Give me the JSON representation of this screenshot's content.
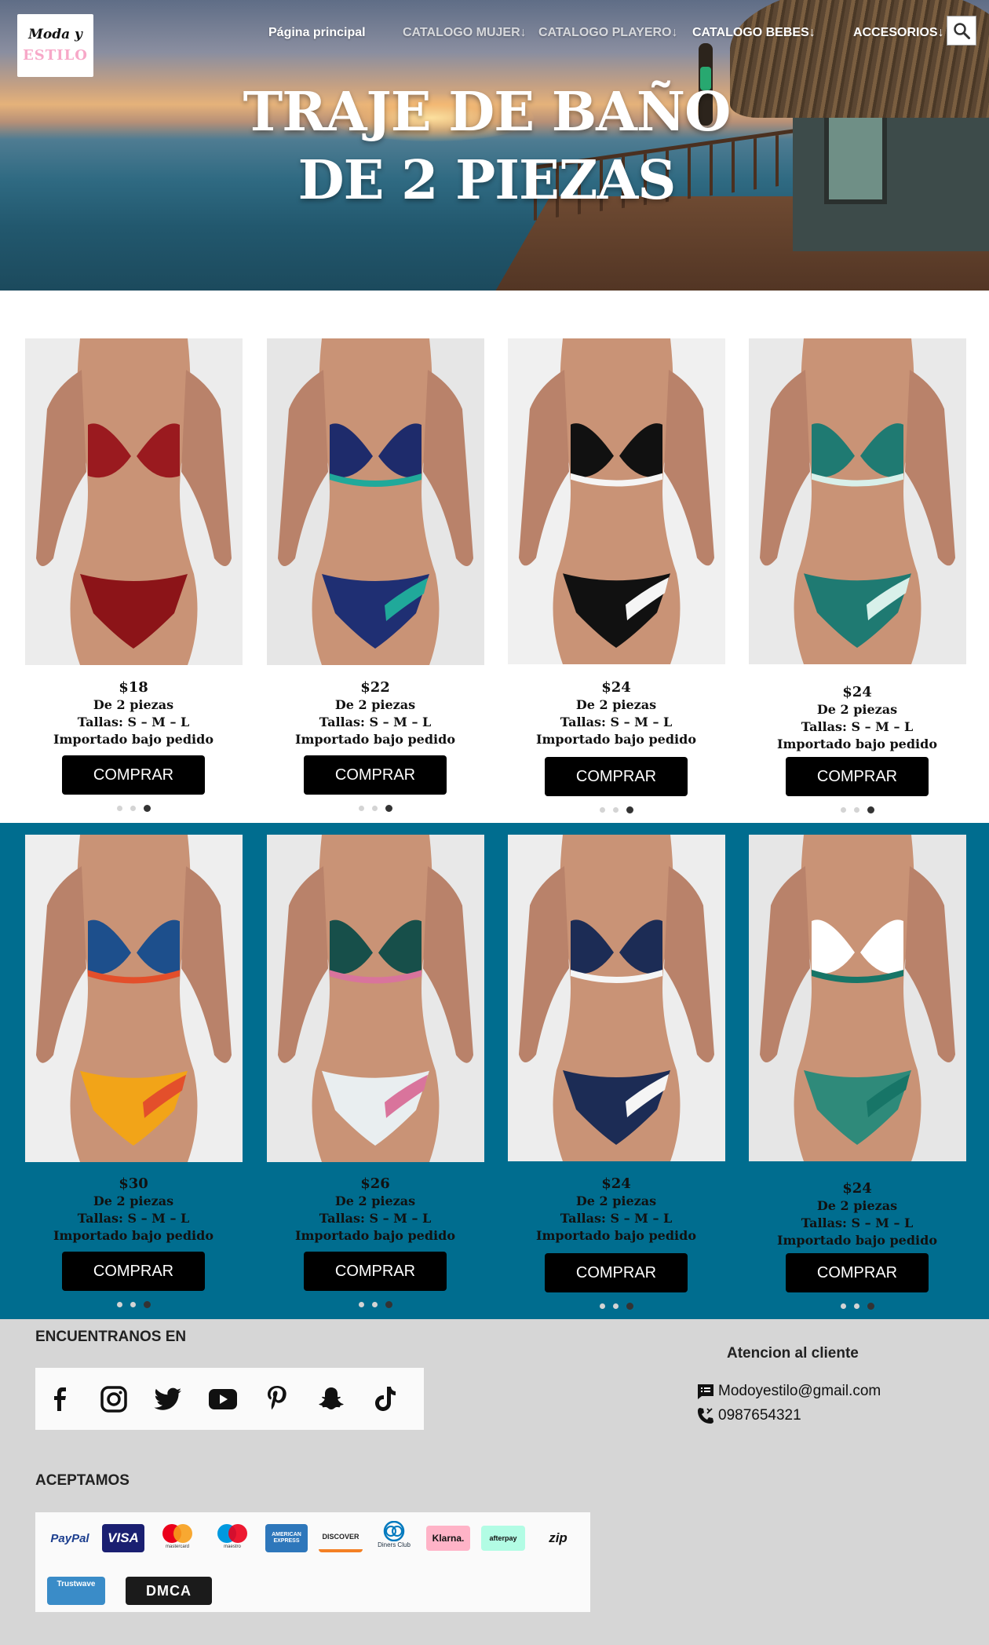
{
  "logo": {
    "line1": "Moda y",
    "line2": "ESTILO"
  },
  "nav": {
    "home": "Página principal",
    "women": "CATALOGO MUJER↓",
    "beach": "CATALOGO PLAYERO↓",
    "babies": "CATALOGO BEBES↓",
    "accessories": "ACCESORIOS↓"
  },
  "hero": {
    "line1": "TRAJE DE BAÑO",
    "line2": "DE 2 PIEZAS"
  },
  "products": [
    {
      "price": "$18",
      "type": "De 2 piezas",
      "sizes": "Tallas: S – M – L",
      "note": "Importado bajo pedido",
      "button": "COMPRAR",
      "active_slide": 3
    },
    {
      "price": "$22",
      "type": "De 2 piezas",
      "sizes": "Tallas: S – M – L",
      "note": "Importado bajo pedido",
      "button": "COMPRAR",
      "active_slide": 3
    },
    {
      "price": "$24",
      "type": "De 2 piezas",
      "sizes": "Tallas: S – M – L",
      "note": "Importado bajo pedido",
      "button": "COMPRAR",
      "active_slide": 3
    },
    {
      "price": "$24",
      "type": "De 2 piezas",
      "sizes": "Tallas: S – M – L",
      "note": "Importado bajo pedido",
      "button": "COMPRAR",
      "active_slide": 3
    },
    {
      "price": "$30",
      "type": "De 2 piezas",
      "sizes": "Tallas: S – M – L",
      "note": "Importado bajo pedido",
      "button": "COMPRAR",
      "active_slide": 3
    },
    {
      "price": "$26",
      "type": "De 2 piezas",
      "sizes": "Tallas: S – M – L",
      "note": "Importado bajo pedido",
      "button": "COMPRAR",
      "active_slide": 3
    },
    {
      "price": "$24",
      "type": "De 2 piezas",
      "sizes": "Tallas: S – M – L",
      "note": "Importado bajo pedido",
      "button": "COMPRAR",
      "active_slide": 3
    },
    {
      "price": "$24",
      "type": "De 2 piezas",
      "sizes": "Tallas: S – M – L",
      "note": "Importado bajo pedido",
      "button": "COMPRAR",
      "active_slide": 3
    }
  ],
  "footer": {
    "find_us": "ENCUENTRANOS EN",
    "social_icons": [
      "facebook-icon",
      "instagram-icon",
      "twitter-icon",
      "youtube-icon",
      "pinterest-icon",
      "snapchat-icon",
      "tiktok-icon"
    ],
    "customer_service": "Atencion al cliente",
    "email": "Modoyestilo@gmail.com",
    "phone": "0987654321",
    "we_accept": "ACEPTAMOS",
    "payments": {
      "paypal": "PayPal",
      "visa": "VISA",
      "mastercard": "mastercard",
      "maestro": "maestro",
      "amex": "AMERICAN EXPRESS",
      "discover": "DISCOVER",
      "diners": "Diners Club",
      "klarna": "Klarna.",
      "afterpay": "afterpay",
      "zip": "zip",
      "trustwave": "Trustwave",
      "dmca": "DMCA"
    }
  },
  "colors": {
    "band": "#006d8f",
    "button": "#000000",
    "footer": "#d6d6d6"
  }
}
